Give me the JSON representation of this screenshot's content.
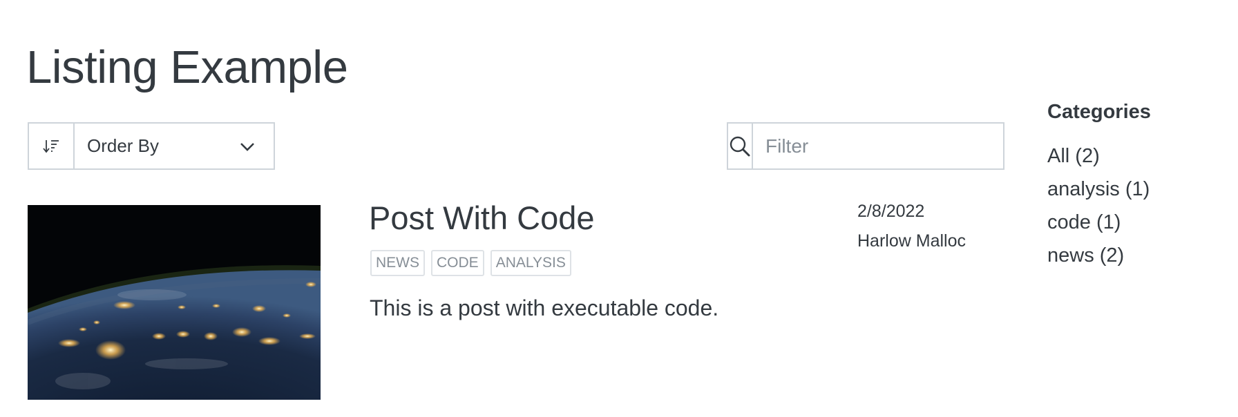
{
  "page": {
    "title": "Listing Example"
  },
  "controls": {
    "sort_icon": "sort-descending-icon",
    "order_by_label": "Order By",
    "order_by_icon": "chevron-down-icon",
    "search_icon": "search-icon",
    "filter_placeholder": "Filter",
    "filter_value": ""
  },
  "listing": {
    "items": [
      {
        "title": "Post With Code",
        "image": "earth-at-night-from-space",
        "tags": [
          "news",
          "code",
          "analysis"
        ],
        "description": "This is a post with executable code.",
        "date": "2/8/2022",
        "author": "Harlow Malloc"
      }
    ]
  },
  "categories": {
    "heading": "Categories",
    "items": [
      {
        "label": "All (2)"
      },
      {
        "label": "analysis (1)"
      },
      {
        "label": "code (1)"
      },
      {
        "label": "news (2)"
      }
    ]
  },
  "colors": {
    "text": "#343a40",
    "muted": "#868e96",
    "border": "#ced4da",
    "tag_border": "#dee2e6"
  }
}
